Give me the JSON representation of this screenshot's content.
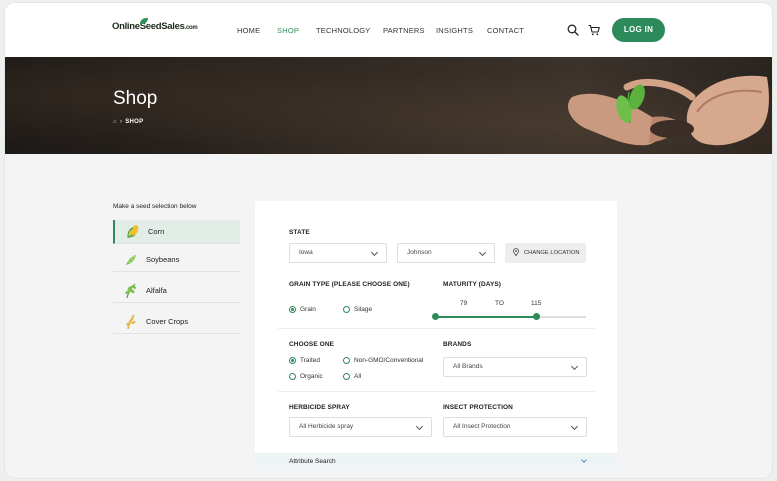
{
  "header": {
    "logo_text": "OnlineSeedSales",
    "logo_suffix": ".com",
    "nav": [
      "HOME",
      "SHOP",
      "TECHNOLOGY",
      "PARTNERS",
      "INSIGHTS",
      "CONTACT"
    ],
    "active_nav": "SHOP",
    "login_label": "LOG IN",
    "icons": [
      "search-icon",
      "cart-icon"
    ]
  },
  "hero": {
    "title": "Shop",
    "breadcrumb": "SHOP"
  },
  "sidebar": {
    "label": "Make a seed selection below",
    "items": [
      {
        "label": "Corn",
        "active": true,
        "icon": "corn-icon"
      },
      {
        "label": "Soybeans",
        "active": false,
        "icon": "soybean-icon"
      },
      {
        "label": "Alfalfa",
        "active": false,
        "icon": "alfalfa-icon"
      },
      {
        "label": "Cover Crops",
        "active": false,
        "icon": "cover-crop-icon"
      }
    ]
  },
  "filters": {
    "state_label": "STATE",
    "state_value": "Iowa",
    "county_value": "Johnson",
    "change_location_label": "CHANGE LOCATION",
    "grain_label": "GRAIN TYPE (PLEASE CHOOSE ONE)",
    "grain_options": [
      {
        "label": "Grain",
        "checked": true
      },
      {
        "label": "Silage",
        "checked": false
      }
    ],
    "maturity_label": "MATURITY (DAYS)",
    "maturity_min": "79",
    "maturity_to": "TO",
    "maturity_max": "115",
    "choose_label": "CHOOSE ONE",
    "choose_options": [
      {
        "label": "Traited",
        "checked": true
      },
      {
        "label": "Non-GMO/Conventional",
        "checked": false
      },
      {
        "label": "Organic",
        "checked": false
      },
      {
        "label": "All",
        "checked": false
      }
    ],
    "brands_label": "BRANDS",
    "brands_value": "All Brands",
    "herbicide_label": "HERBICIDE SPRAY",
    "herbicide_value": "All Herbicide spray",
    "insect_label": "INSECT PROTECTION",
    "insect_value": "All Insect Protection",
    "attribute_search_label": "Attribute Search"
  },
  "colors": {
    "accent": "#2d8a5b",
    "hero_dark": "#2a241f"
  }
}
